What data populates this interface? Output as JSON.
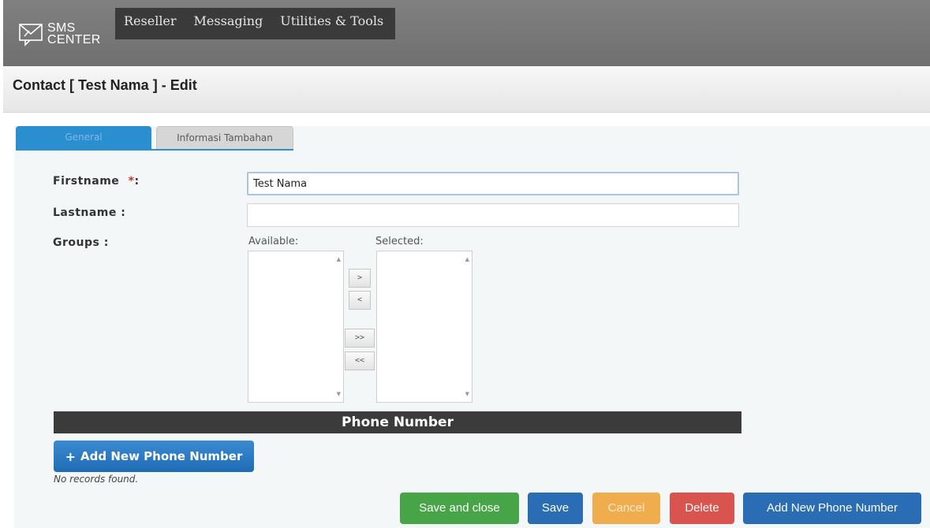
{
  "app": {
    "logo_text_line1": "SMS",
    "logo_text_line2": "CENTER"
  },
  "menu": {
    "items": [
      "Reseller",
      "Messaging",
      "Utilities & Tools"
    ]
  },
  "page": {
    "title": "Contact [ Test Nama ] - Edit"
  },
  "tabs": [
    {
      "label": "General",
      "active": true
    },
    {
      "label": "Informasi Tambahan",
      "active": false
    }
  ],
  "form": {
    "firstname_label": "Firstname",
    "required_mark": "*",
    "colon": ":",
    "firstname_value": "Test Nama",
    "lastname_label": "Lastname :",
    "lastname_value": "",
    "groups_label": "Groups :",
    "available_label": "Available:",
    "selected_label": "Selected:",
    "move_right": ">",
    "move_left": "<",
    "move_all_right": ">>",
    "move_all_left": "<<"
  },
  "phone_section": {
    "title": "Phone Number",
    "add_button_icon": "+",
    "add_button_label": "Add New Phone Number",
    "empty_text": "No records found."
  },
  "actions": {
    "save_and_close": "Save and close",
    "save": "Save",
    "cancel": "Cancel",
    "delete": "Delete",
    "add_new_phone": "Add New Phone Number"
  },
  "colors": {
    "topbar": "#777777",
    "menu_bg": "#3a3a3a",
    "tab_active": "#2b8ecf",
    "success": "#47a447",
    "primary": "#2a6db5",
    "warning": "#f0ad4e",
    "danger": "#d9534f"
  }
}
